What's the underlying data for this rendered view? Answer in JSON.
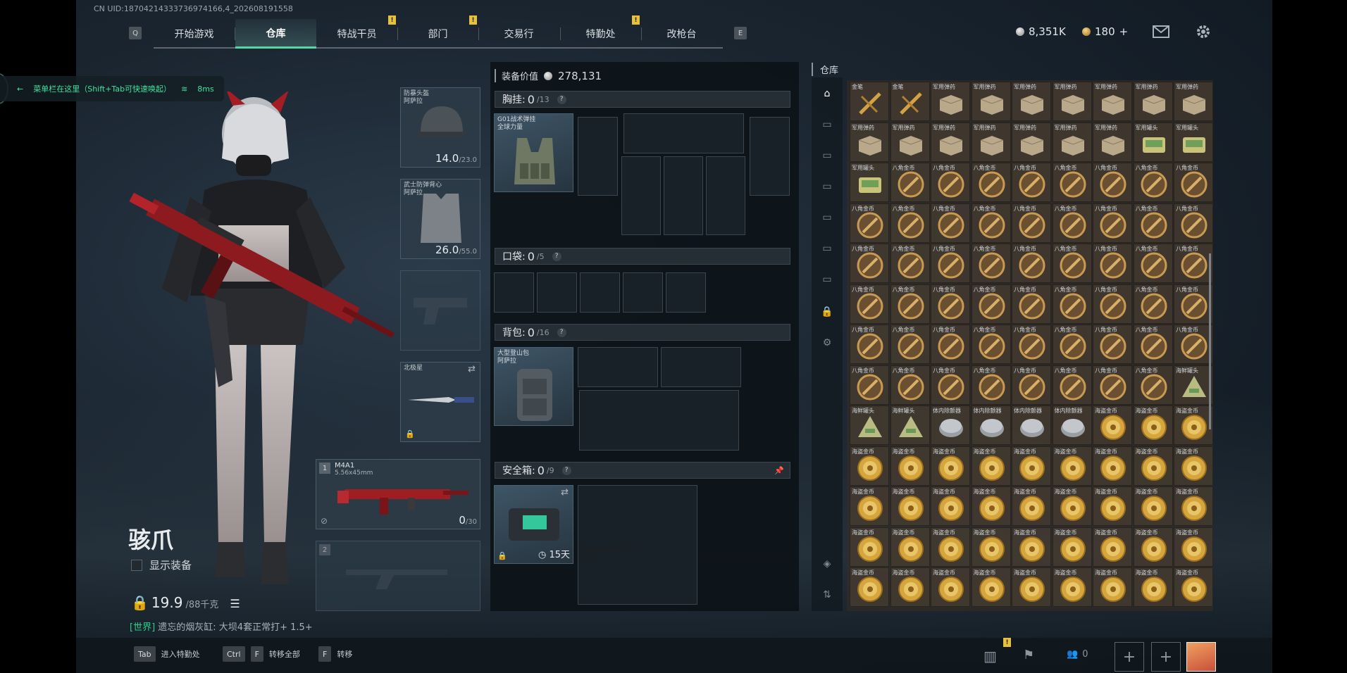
{
  "header": {
    "uid": "CN UID:18704214333736974166,4_202608191558"
  },
  "nav": {
    "left_key": "Q",
    "right_key": "E",
    "tabs": [
      {
        "label": "开始游戏"
      },
      {
        "label": "仓库"
      },
      {
        "label": "特战干员"
      },
      {
        "label": "部门"
      },
      {
        "label": "交易行"
      },
      {
        "label": "特勤处"
      },
      {
        "label": "改枪台"
      }
    ],
    "alert_mark": "!"
  },
  "currency": {
    "silver": "8,351K",
    "gold": "180",
    "plus": "+"
  },
  "hint": {
    "text": "菜单栏在这里（Shift+Tab可快速唤起）",
    "ping": "8ms"
  },
  "character": {
    "name": "骇爪",
    "show_equipment": "显示装备",
    "weight": "19.9",
    "weight_max": "/88千克"
  },
  "chat": {
    "channel": "[世界]",
    "message": "遗忘的烟灰缸: 大坝4套正常打+ 1.5+"
  },
  "equipment": {
    "helmet": {
      "name": "防暴头盔\n阿萨拉",
      "value": "14.0",
      "max": "/23.0"
    },
    "armor": {
      "name": "武士防弹背心\n阿萨拉",
      "value": "26.0",
      "max": "/55.0"
    },
    "melee": {
      "name": "北极星"
    },
    "primary": {
      "slot": "1",
      "name": "M4A1",
      "caliber": "5.56x45mm",
      "ammo": "0",
      "ammo_max": "/30"
    },
    "secondary": {
      "slot": "2"
    }
  },
  "container": {
    "value_label": "装备价值",
    "value": "278,131",
    "chest": {
      "label": "胸挂:",
      "count": "0",
      "cap": "/13",
      "item": "G01战术弹挂\n全球力量"
    },
    "pocket": {
      "label": "口袋:",
      "count": "0",
      "cap": "/5"
    },
    "backpack": {
      "label": "背包:",
      "count": "0",
      "cap": "/16",
      "item": "大型登山包\n阿萨拉"
    },
    "safe": {
      "label": "安全箱:",
      "count": "0",
      "cap": "/9",
      "timer": "15天"
    },
    "help": "?"
  },
  "warehouse": {
    "title": "仓库",
    "rows": [
      [
        "金笔",
        "金笔",
        "军用弹药",
        "军用弹药",
        "军用弹药",
        "军用弹药",
        "军用弹药",
        "军用弹药",
        "军用弹药"
      ],
      [
        "军用弹药",
        "军用弹药",
        "军用弹药",
        "军用弹药",
        "军用弹药",
        "军用弹药",
        "军用弹药",
        "军用罐头",
        "军用罐头"
      ],
      [
        "军用罐头",
        "八角金币",
        "八角金币",
        "八角金币",
        "八角金币",
        "八角金币",
        "八角金币",
        "八角金币",
        "八角金币"
      ],
      [
        "八角金币",
        "八角金币",
        "八角金币",
        "八角金币",
        "八角金币",
        "八角金币",
        "八角金币",
        "八角金币",
        "八角金币"
      ],
      [
        "八角金币",
        "八角金币",
        "八角金币",
        "八角金币",
        "八角金币",
        "八角金币",
        "八角金币",
        "八角金币",
        "八角金币"
      ],
      [
        "八角金币",
        "八角金币",
        "八角金币",
        "八角金币",
        "八角金币",
        "八角金币",
        "八角金币",
        "八角金币",
        "八角金币"
      ],
      [
        "八角金币",
        "八角金币",
        "八角金币",
        "八角金币",
        "八角金币",
        "八角金币",
        "八角金币",
        "八角金币",
        "八角金币"
      ],
      [
        "八角金币",
        "八角金币",
        "八角金币",
        "八角金币",
        "八角金币",
        "八角金币",
        "八角金币",
        "八角金币",
        "海鲜罐头"
      ],
      [
        "海鲜罐头",
        "海鲜罐头",
        "体内除颤器",
        "体内除颤器",
        "体内除颤器",
        "体内除颤器",
        "海盗金币",
        "海盗金币",
        "海盗金币"
      ],
      [
        "海盗金币",
        "海盗金币",
        "海盗金币",
        "海盗金币",
        "海盗金币",
        "海盗金币",
        "海盗金币",
        "海盗金币",
        "海盗金币"
      ],
      [
        "海盗金币",
        "海盗金币",
        "海盗金币",
        "海盗金币",
        "海盗金币",
        "海盗金币",
        "海盗金币",
        "海盗金币",
        "海盗金币"
      ],
      [
        "海盗金币",
        "海盗金币",
        "海盗金币",
        "海盗金币",
        "海盗金币",
        "海盗金币",
        "海盗金币",
        "海盗金币",
        "海盗金币"
      ],
      [
        "海盗金币",
        "海盗金币",
        "海盗金币",
        "海盗金币",
        "海盗金币",
        "海盗金币",
        "海盗金币",
        "海盗金币",
        "海盗金币"
      ]
    ],
    "icon_kinds": {
      "金笔": "pen",
      "军用弹药": "ammo",
      "军用罐头": "can",
      "八角金币": "octcoin",
      "海鲜罐头": "tri",
      "体内除颤器": "disc",
      "海盗金币": "pirate"
    }
  },
  "bottom": {
    "tab_key": "Tab",
    "tab_action": "进入特勤处",
    "ctrl_key": "Ctrl",
    "f_key": "F",
    "transfer_all": "转移全部",
    "f2_key": "F",
    "transfer": "转移",
    "team_count": "0"
  },
  "colors": {
    "accent": "#55d6a4",
    "alert": "#e7c13a",
    "hint_text": "#3fe39b"
  }
}
